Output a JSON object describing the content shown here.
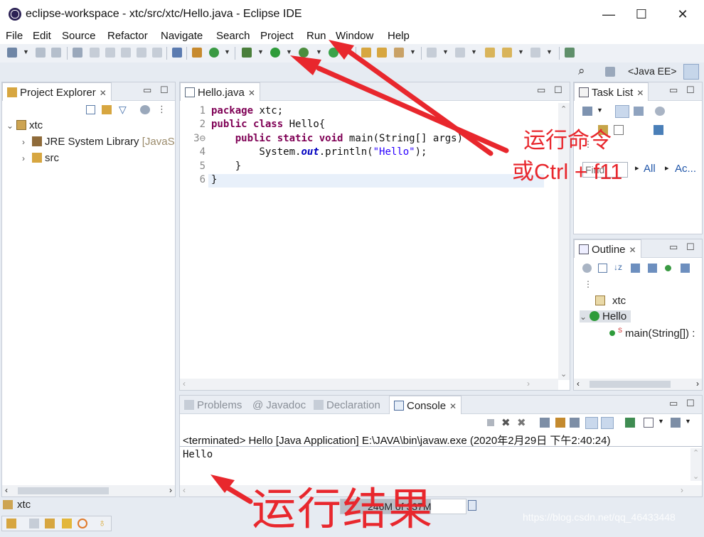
{
  "window": {
    "title": "eclipse-workspace - xtc/src/xtc/Hello.java - Eclipse IDE",
    "minimize": "—",
    "maximize": "☐",
    "close": "✕"
  },
  "menu": [
    "File",
    "Edit",
    "Source",
    "Refactor",
    "Navigate",
    "Search",
    "Project",
    "Run",
    "Window",
    "Help"
  ],
  "perspective": {
    "label": "<Java EE>"
  },
  "project_explorer": {
    "title": "Project Explorer",
    "project": "xtc",
    "jre_label": "JRE System Library",
    "jre_suffix": "[JavaS",
    "src": "src"
  },
  "editor": {
    "tab": "Hello.java",
    "line_numbers": [
      "1",
      "2",
      "3⊖",
      "4",
      "5",
      "6"
    ],
    "lines": {
      "l1_kw": "package",
      "l1_rest": " xtc;",
      "l2_kw1": "public",
      "l2_kw2": "class",
      "l2_rest": " Hello{",
      "l3_indent": "    ",
      "l3_kw1": "public",
      "l3_kw2": "static",
      "l3_kw3": "void",
      "l3_rest": " main(String[] args) {",
      "l4_pre": "        System.",
      "l4_out": "out",
      "l4_mid": ".println(",
      "l4_str": "\"Hello\"",
      "l4_end": ");",
      "l5": "    }",
      "l6": "}"
    }
  },
  "task_list": {
    "title": "Task List",
    "find_placeholder": "Find",
    "all": "All",
    "activate": "Ac..."
  },
  "outline": {
    "title": "Outline",
    "package": "xtc",
    "class": "Hello",
    "method": "main(String[]) :"
  },
  "bottom_tabs": {
    "problems": "Problems",
    "javadoc": "Javadoc",
    "declaration": "Declaration",
    "console": "Console"
  },
  "console": {
    "header": "<terminated> Hello [Java Application] E:\\JAVA\\bin\\javaw.exe (2020年2月29日 下午2:40:24)",
    "output": "Hello"
  },
  "status": {
    "selection": "xtc",
    "heap": "246M of 337M"
  },
  "annotations": {
    "run_command_line1": "运行命令",
    "run_command_line2": "或Ctrl + f11",
    "run_result": "运行结果",
    "watermark": "https://blog.csdn.net/qq_46433448"
  },
  "colors": {
    "annotation_red": "#e8272d",
    "keyword": "#7f0055",
    "string": "#2a00ff",
    "run_green": "#2e9b3a"
  }
}
